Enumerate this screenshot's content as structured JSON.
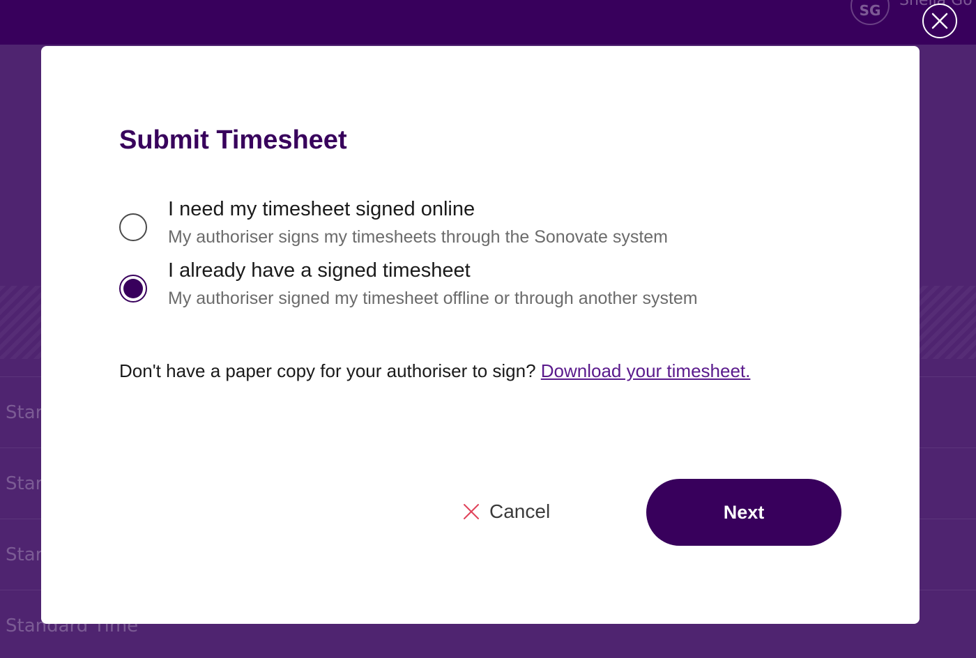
{
  "background": {
    "avatar_initials": "SG",
    "user_name": "Sheila Go",
    "rows": [
      "Star",
      "Star",
      "Star",
      "Standard Time"
    ]
  },
  "modal": {
    "title": "Submit Timesheet",
    "options": [
      {
        "label": "I need my timesheet signed online",
        "description": "My authoriser signs my timesheets through the Sonovate system",
        "selected": false
      },
      {
        "label": "I already have a signed timesheet",
        "description": "My authoriser signed my timesheet offline or through another system",
        "selected": true
      }
    ],
    "paper_prompt": "Don't have a paper copy for your authoriser to sign?",
    "download_link": "Download your timesheet.",
    "cancel_label": "Cancel",
    "next_label": "Next"
  },
  "icons": {
    "close": "close-icon",
    "cancel": "cancel-x-icon"
  },
  "colors": {
    "brand": "#38005c",
    "overlay": "#4f2470",
    "cancel_icon": "#e0435a",
    "link": "#5a1a8c"
  }
}
